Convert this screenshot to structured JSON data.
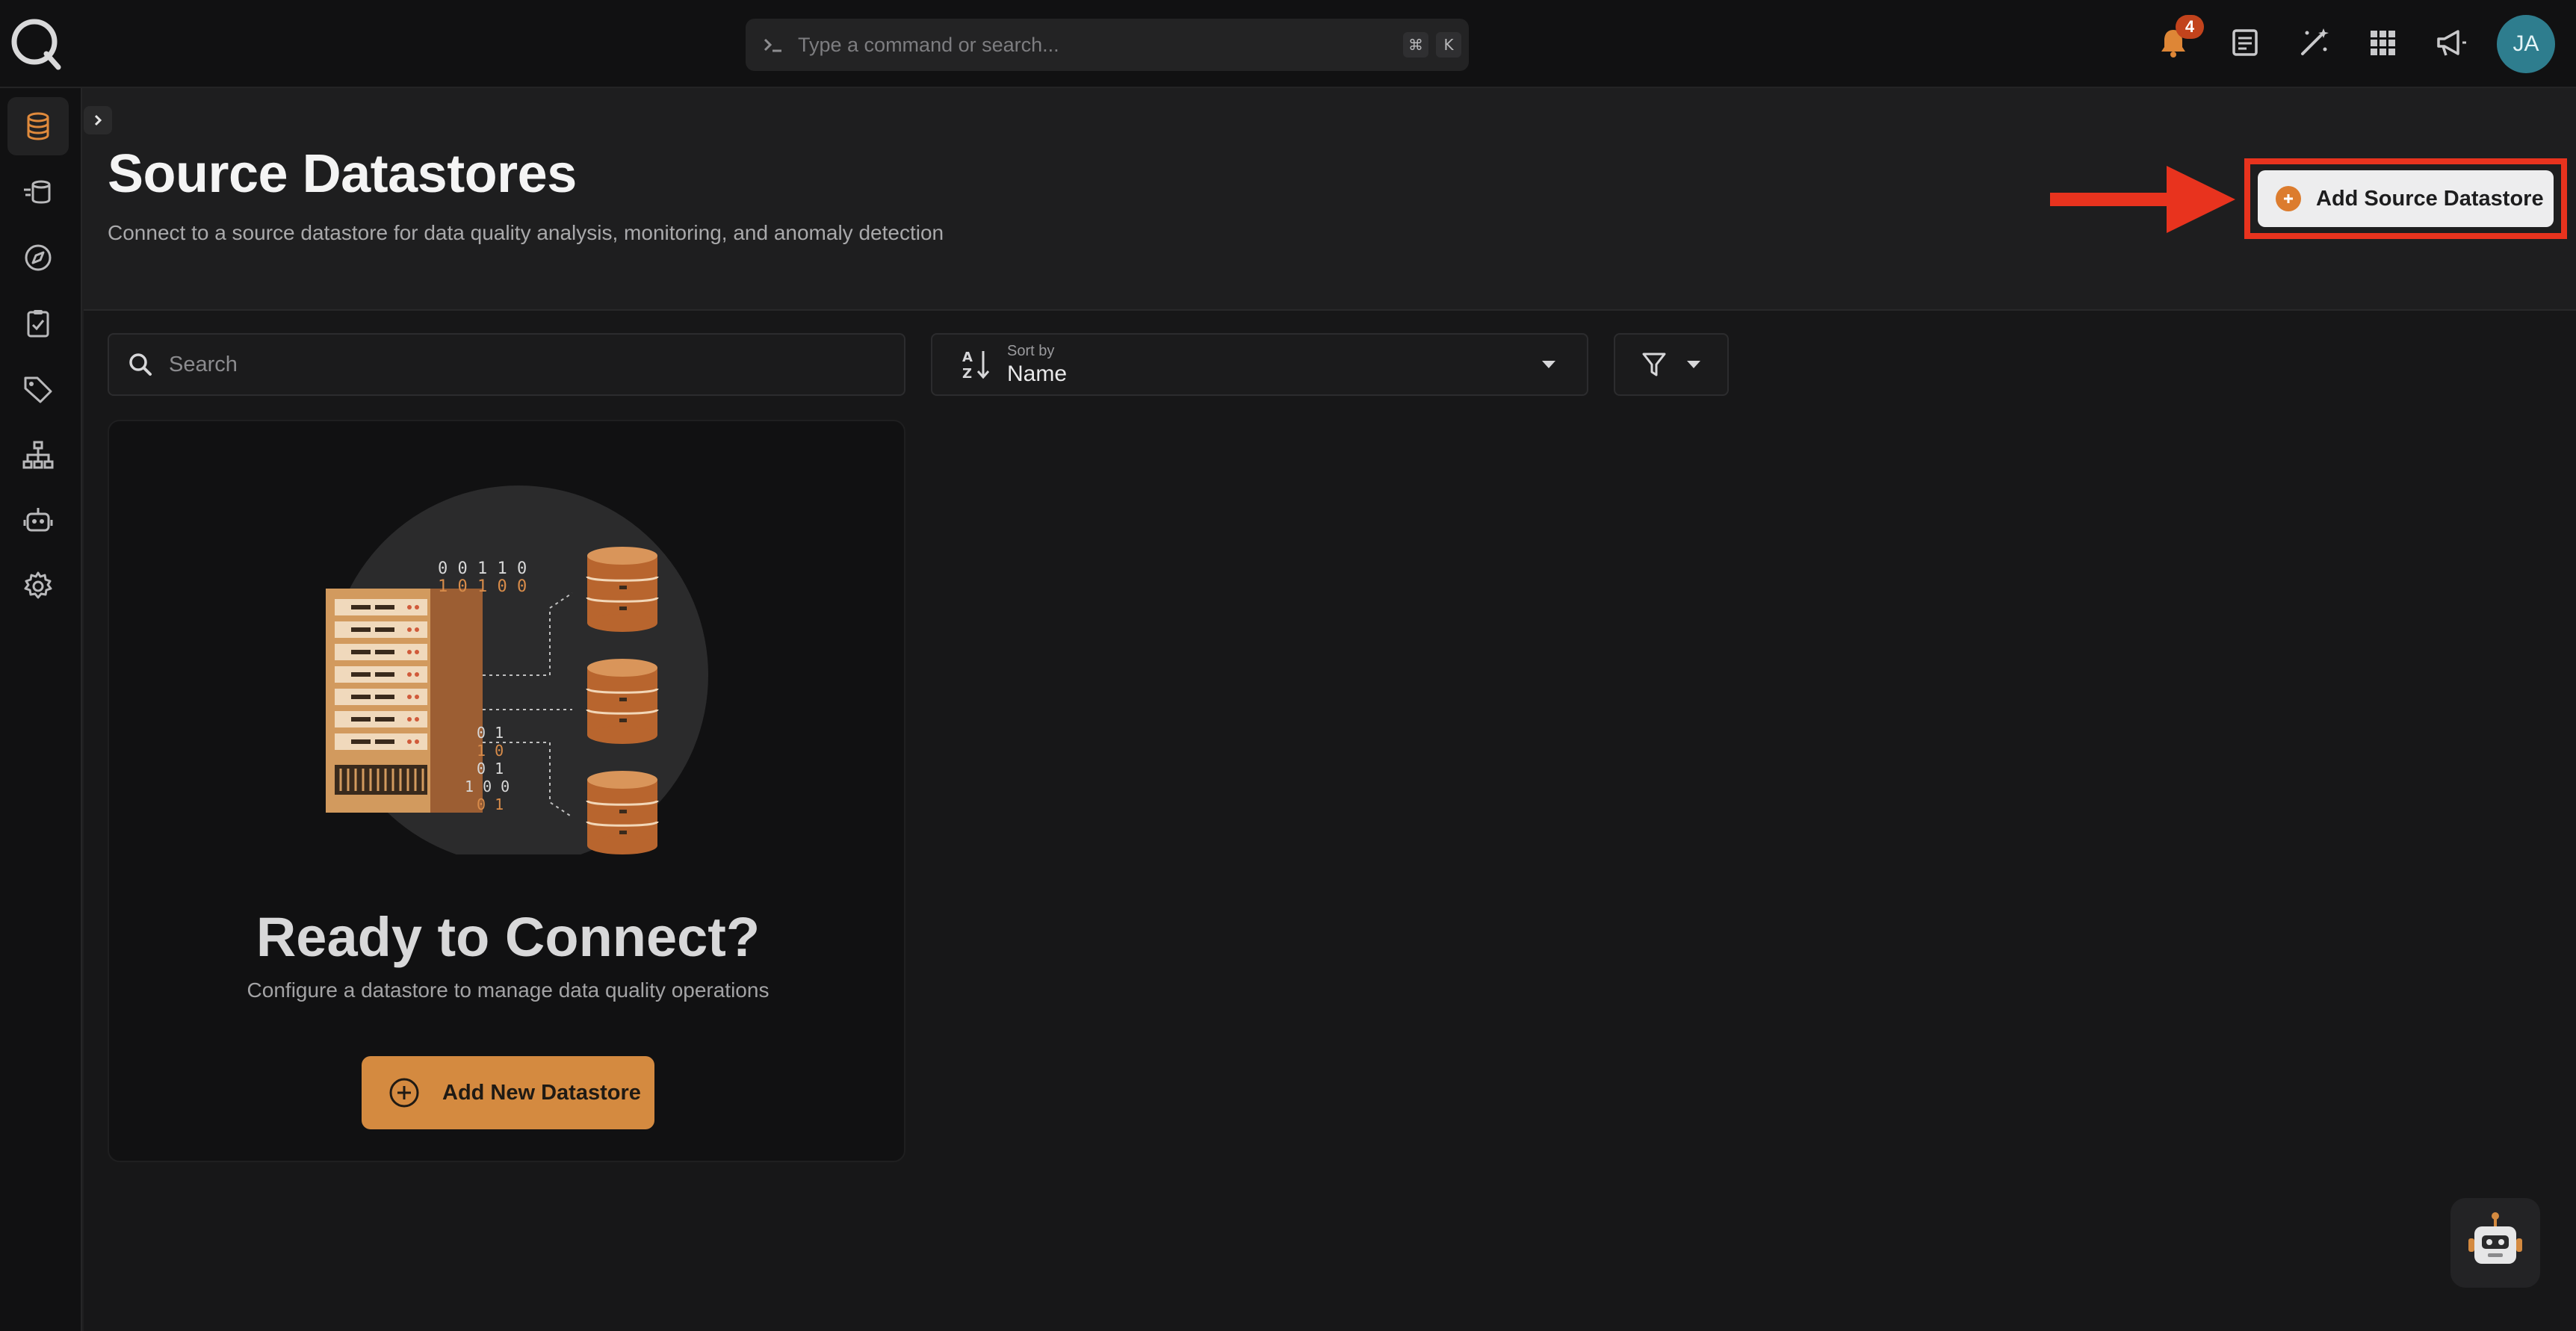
{
  "topbar": {
    "command_placeholder": "Type a command or search...",
    "shortcut_mod": "⌘",
    "shortcut_key": "K",
    "notification_count": "4",
    "avatar_initials": "JA"
  },
  "sidebar": {
    "items": [
      {
        "icon": "database-icon",
        "active": true
      },
      {
        "icon": "datastore-flow-icon"
      },
      {
        "icon": "compass-icon"
      },
      {
        "icon": "clipboard-check-icon"
      },
      {
        "icon": "tag-icon"
      },
      {
        "icon": "hierarchy-icon"
      },
      {
        "icon": "robot-icon"
      },
      {
        "icon": "gear-icon"
      }
    ]
  },
  "header": {
    "title": "Source Datastores",
    "subtitle": "Connect to a source datastore for data quality analysis, monitoring, and anomaly detection",
    "add_button_label": "Add Source Datastore"
  },
  "controls": {
    "search_placeholder": "Search",
    "sort_caption": "Sort by",
    "sort_value": "Name"
  },
  "empty_state": {
    "binary_top_1": "0 0 1 1 0",
    "binary_top_2": "1 0 1 0 0",
    "binary_bottom": [
      "0 1",
      "1 0",
      "0 1",
      "1 0 0",
      "0 1"
    ],
    "heading": "Ready to Connect?",
    "description": "Configure a datastore to manage data quality operations",
    "button_label": "Add New Datastore"
  },
  "colors": {
    "accent": "#d48a40",
    "highlight": "#e8331e",
    "background": "#1e1e1f"
  }
}
